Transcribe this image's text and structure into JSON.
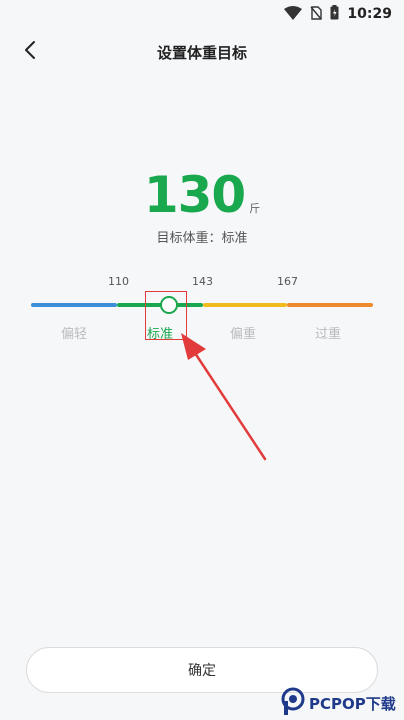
{
  "status_bar": {
    "time": "10:29",
    "icons": [
      "wifi-icon",
      "no-sim-icon",
      "battery-icon"
    ]
  },
  "header": {
    "title": "设置体重目标",
    "back_icon": "chevron-left-icon"
  },
  "weight": {
    "value": "130",
    "unit": "斤"
  },
  "target": {
    "label": "目标体重：标准"
  },
  "scale": {
    "thresholds": [
      "110",
      "143",
      "167"
    ],
    "categories": [
      {
        "label": "偏轻",
        "color": "#3b8fd9"
      },
      {
        "label": "标准",
        "color": "#1aa84e"
      },
      {
        "label": "偏重",
        "color": "#f2bb1c"
      },
      {
        "label": "过重",
        "color": "#ef8a2c"
      }
    ],
    "active_category": "标准"
  },
  "confirm_button": {
    "label": "确定"
  },
  "watermark": {
    "text": "PCPOP下载"
  },
  "colors": {
    "accent": "#1aa84e",
    "annotation": "#e23b3b"
  }
}
